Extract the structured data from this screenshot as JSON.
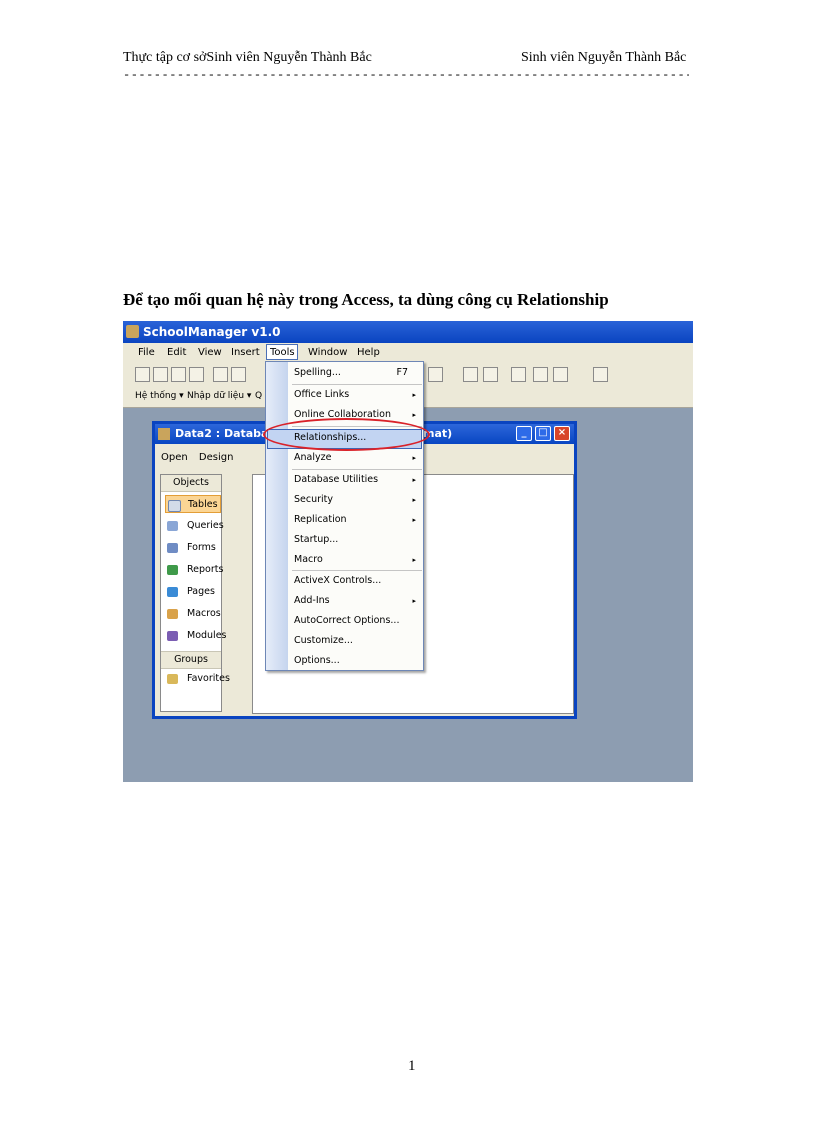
{
  "header": {
    "left": "Thực tập cơ sởSinh  viên  Nguyễn  Thành  Bắc",
    "right": "Sinh  viên  Nguyễn  Thành  Bắc",
    "rule": "------------------------------------------------------------------------------------------------------------------"
  },
  "heading": "Để tạo mối quan hệ này trong Access, ta dùng công cụ Relationship",
  "page_number": "1",
  "screenshot": {
    "app_title": "SchoolManager v1.0",
    "menubar": [
      "File",
      "Edit",
      "View",
      "Insert",
      "Tools",
      "Window",
      "Help"
    ],
    "toolbar2": [
      "Hệ thống ▾",
      "Nhập dữ liệu ▾",
      "Q"
    ],
    "db_window": {
      "title_left": "Data2 : Database",
      "title_right": "mat)",
      "open_label": "Open",
      "design_label": "Design",
      "objects_header": "Objects",
      "objects": [
        {
          "label": "Tables",
          "icon": "table-icon",
          "color": "#d2dbe8"
        },
        {
          "label": "Queries",
          "icon": "query-icon",
          "color": "#8aa6d6"
        },
        {
          "label": "Forms",
          "icon": "form-icon",
          "color": "#6f8cc4"
        },
        {
          "label": "Reports",
          "icon": "report-icon",
          "color": "#3f9a4a"
        },
        {
          "label": "Pages",
          "icon": "page-icon",
          "color": "#3a8bd6"
        },
        {
          "label": "Macros",
          "icon": "macro-icon",
          "color": "#d9a24a"
        },
        {
          "label": "Modules",
          "icon": "module-icon",
          "color": "#7b5db3"
        }
      ],
      "groups_header": "Groups",
      "favorites_label": "Favorites"
    },
    "tools_menu": {
      "items": [
        {
          "label": "Spelling...",
          "shortcut": "F7"
        },
        {
          "label": "Office Links",
          "submenu": "▸"
        },
        {
          "label": "Online Collaboration",
          "submenu": "▸"
        },
        {
          "label": "Relationships..."
        },
        {
          "label": "Analyze",
          "submenu": "▸"
        },
        {
          "label": "Database Utilities",
          "submenu": "▸"
        },
        {
          "label": "Security",
          "submenu": "▸"
        },
        {
          "label": "Replication",
          "submenu": "▸"
        },
        {
          "label": "Startup..."
        },
        {
          "label": "Macro",
          "submenu": "▸"
        },
        {
          "label": "ActiveX Controls..."
        },
        {
          "label": "Add-Ins",
          "submenu": "▸"
        },
        {
          "label": "AutoCorrect Options..."
        },
        {
          "label": "Customize..."
        },
        {
          "label": "Options..."
        }
      ]
    },
    "colors": {
      "titlebar": "#0a44c0",
      "highlight_circle": "#d9222a",
      "desktop": "#8d9db1"
    }
  }
}
